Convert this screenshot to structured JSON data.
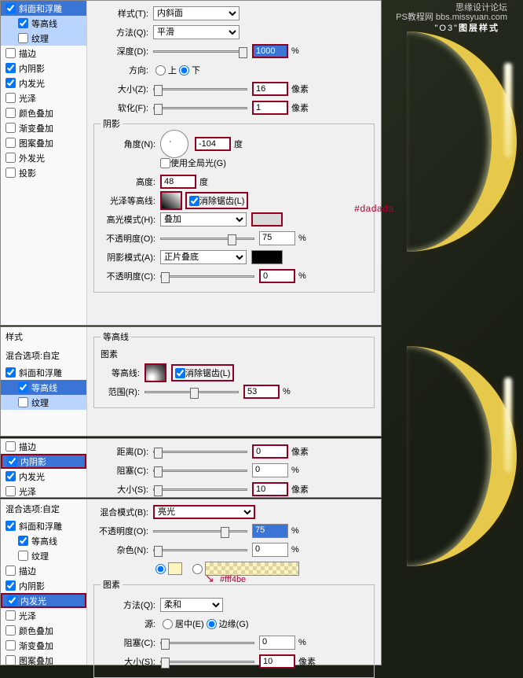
{
  "overlay": {
    "watermark_line1": "思缘设计论坛",
    "watermark_line2": "PS教程网",
    "watermark_url": "bbs.missyuan.com",
    "title_prefix": "\"O3\"",
    "title_suffix": "图层样式"
  },
  "section1": {
    "sidebar": [
      {
        "label": "斜面和浮雕",
        "checked": true,
        "sel": "sel",
        "indent": false
      },
      {
        "label": "等高线",
        "checked": true,
        "sel": "sel-light",
        "indent": true
      },
      {
        "label": "纹理",
        "checked": false,
        "sel": "sel-light",
        "indent": true
      },
      {
        "label": "描边",
        "checked": false,
        "sel": "",
        "indent": false
      },
      {
        "label": "内阴影",
        "checked": true,
        "sel": "",
        "indent": false
      },
      {
        "label": "内发光",
        "checked": true,
        "sel": "",
        "indent": false
      },
      {
        "label": "光泽",
        "checked": false,
        "sel": "",
        "indent": false
      },
      {
        "label": "颜色叠加",
        "checked": false,
        "sel": "",
        "indent": false
      },
      {
        "label": "渐变叠加",
        "checked": false,
        "sel": "",
        "indent": false
      },
      {
        "label": "图案叠加",
        "checked": false,
        "sel": "",
        "indent": false
      },
      {
        "label": "外发光",
        "checked": false,
        "sel": "",
        "indent": false
      },
      {
        "label": "投影",
        "checked": false,
        "sel": "",
        "indent": false
      }
    ],
    "style_label": "样式(T):",
    "style_value": "内斜面",
    "method_label": "方法(Q):",
    "method_value": "平滑",
    "depth_label": "深度(D):",
    "depth_value": "1000",
    "depth_unit": "%",
    "direction_label": "方向:",
    "dir_up": "上",
    "dir_down": "下",
    "size_label": "大小(Z):",
    "size_value": "16",
    "size_unit": "像素",
    "soften_label": "软化(F):",
    "soften_value": "1",
    "soften_unit": "像素",
    "shadow_group": "阴影",
    "angle_label": "角度(N):",
    "angle_value": "-104",
    "angle_unit": "度",
    "global_label": "使用全局光(G)",
    "alt_label": "高度:",
    "alt_value": "48",
    "alt_unit": "度",
    "gloss_label": "光泽等高线:",
    "antialias": "消除锯齿(L)",
    "hilite_label": "高光模式(H):",
    "hilite_value": "叠加",
    "opacity_label": "不透明度(O):",
    "opacity_value": "75",
    "opacity_unit": "%",
    "shadow_label": "阴影模式(A):",
    "shadow_value": "正片叠底",
    "opacity2_label": "不透明度(C):",
    "opacity2_value": "0",
    "opacity2_unit": "%",
    "anno_color": "#dadada"
  },
  "section2": {
    "head": "样式",
    "sub": "混合选项:自定",
    "sidebar": [
      {
        "label": "斜面和浮雕",
        "checked": true,
        "sel": "",
        "indent": false
      },
      {
        "label": "等高线",
        "checked": true,
        "sel": "sel",
        "indent": true
      },
      {
        "label": "纹理",
        "checked": false,
        "sel": "sel-light",
        "indent": true
      }
    ],
    "group": "等高线",
    "subgroup": "图素",
    "contour_label": "等高线:",
    "antialias": "消除锯齿(L)",
    "range_label": "范围(R):",
    "range_value": "53",
    "range_unit": "%"
  },
  "section3": {
    "sidebar": [
      {
        "label": "描边",
        "checked": false,
        "sel": "",
        "hl": false
      },
      {
        "label": "内阴影",
        "checked": true,
        "sel": "sel",
        "hl": true
      },
      {
        "label": "内发光",
        "checked": true,
        "sel": "",
        "hl": false
      },
      {
        "label": "光泽",
        "checked": false,
        "sel": "",
        "hl": false
      }
    ],
    "dist_label": "距离(D):",
    "dist_value": "0",
    "dist_unit": "像素",
    "choke_label": "阻塞(C):",
    "choke_value": "0",
    "choke_unit": "%",
    "size_label": "大小(S):",
    "size_value": "10",
    "size_unit": "像素"
  },
  "section4": {
    "head": "混合选项:自定",
    "sidebar": [
      {
        "label": "斜面和浮雕",
        "checked": true,
        "sel": "",
        "hl": false
      },
      {
        "label": "等高线",
        "checked": true,
        "sel": "",
        "hl": false,
        "indent": true
      },
      {
        "label": "纹理",
        "checked": false,
        "sel": "",
        "hl": false,
        "indent": true
      },
      {
        "label": "描边",
        "checked": false,
        "sel": "",
        "hl": false
      },
      {
        "label": "内阴影",
        "checked": true,
        "sel": "",
        "hl": false
      },
      {
        "label": "内发光",
        "checked": true,
        "sel": "sel",
        "hl": true
      },
      {
        "label": "光泽",
        "checked": false,
        "sel": "",
        "hl": false
      },
      {
        "label": "颜色叠加",
        "checked": false,
        "sel": "",
        "hl": false
      },
      {
        "label": "渐变叠加",
        "checked": false,
        "sel": "",
        "hl": false
      },
      {
        "label": "图案叠加",
        "checked": false,
        "sel": "",
        "hl": false
      }
    ],
    "blend_label": "混合模式(B):",
    "blend_value": "亮光",
    "opacity_label": "不透明度(O):",
    "opacity_value": "75",
    "opacity_unit": "%",
    "noise_label": "杂色(N):",
    "noise_value": "0",
    "noise_unit": "%",
    "group": "图素",
    "method_label": "方法(Q):",
    "method_value": "柔和",
    "source_label": "源:",
    "src_center": "居中(E)",
    "src_edge": "边缘(G)",
    "choke_label": "阻塞(C):",
    "choke_value": "0",
    "choke_unit": "%",
    "size_label": "大小(S):",
    "size_value": "10",
    "size_unit": "像素",
    "anno_color": "#fff4be"
  }
}
